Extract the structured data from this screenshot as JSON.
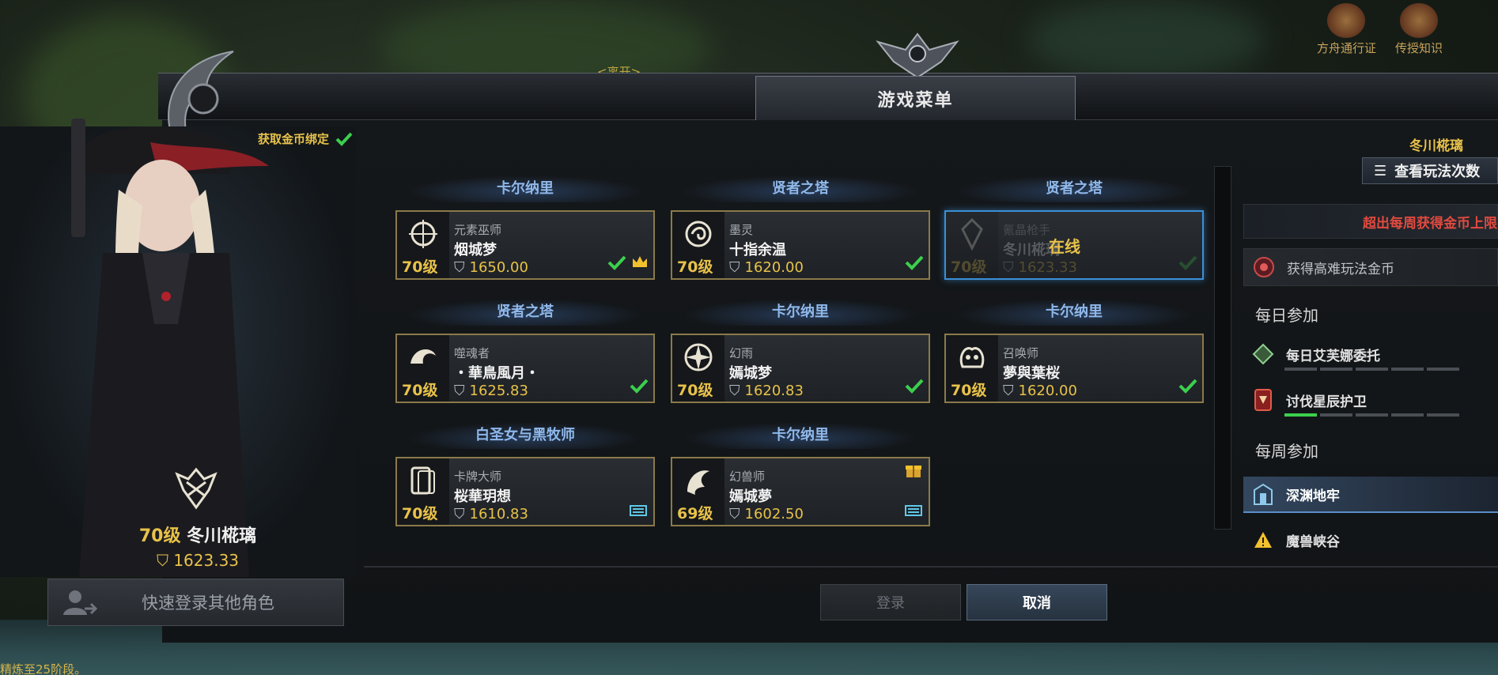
{
  "world": {
    "floating_text_1": "<离开>",
    "top_icons": [
      {
        "label": "方舟通行证",
        "icon": "ark-pass-icon"
      },
      {
        "label": "传授知识",
        "icon": "knowledge-icon"
      }
    ],
    "bottom_hint": "精炼至25阶段。"
  },
  "dialog": {
    "title": "游戏菜单",
    "gold_bound_label": "获取金币绑定"
  },
  "selected_character": {
    "level": "70级",
    "name": "冬川椛璃",
    "item_level": "1623.33",
    "quick_login_label": "快速登录其他角色"
  },
  "characters": [
    {
      "server": "卡尔纳里",
      "class": "元素巫师",
      "name": "烟城梦",
      "level": "70级",
      "item_level": "1650.00",
      "badges": [
        "check-icon",
        "crown-icon"
      ],
      "online": false
    },
    {
      "server": "贤者之塔",
      "class": "墨灵",
      "name": "十指余温",
      "level": "70级",
      "item_level": "1620.00",
      "badges": [
        "check-icon"
      ],
      "online": false
    },
    {
      "server": "贤者之塔",
      "class": "氪晶枪手",
      "name": "冬川椛璃",
      "level": "70级",
      "item_level": "1623.33",
      "badges": [
        "check-icon"
      ],
      "online": true,
      "online_label": "在线"
    },
    {
      "server": "贤者之塔",
      "class": "噬魂者",
      "name": "・華鳥風月・",
      "level": "70级",
      "item_level": "1625.83",
      "badges": [
        "check-icon"
      ],
      "online": false
    },
    {
      "server": "卡尔纳里",
      "class": "幻雨",
      "name": "嫣城梦",
      "level": "70级",
      "item_level": "1620.83",
      "badges": [
        "check-icon"
      ],
      "online": false
    },
    {
      "server": "卡尔纳里",
      "class": "召唤师",
      "name": "夢與葉桜",
      "level": "70级",
      "item_level": "1620.00",
      "badges": [
        "check-icon"
      ],
      "online": false
    },
    {
      "server": "白圣女与黑牧师",
      "class": "卡牌大师",
      "name": "桜華玥想",
      "level": "70级",
      "item_level": "1610.83",
      "badges": [
        "crystal-icon"
      ],
      "online": false
    },
    {
      "server": "卡尔纳里",
      "class": "幻兽师",
      "name": "嫣城夢",
      "level": "69级",
      "item_level": "1602.50",
      "badges": [
        "crystal-icon"
      ],
      "gift": true,
      "online": false
    }
  ],
  "buttons": {
    "login": "登录",
    "cancel": "取消"
  },
  "right_panel": {
    "name": "冬川椛璃",
    "count_button": "查看玩法次数",
    "warning": "超出每周获得金币上限",
    "hard_gold": "获得高难玩法金币",
    "daily_header": "每日参加",
    "daily": [
      {
        "label": "每日艾芙娜委托",
        "progress_filled": 0,
        "progress_total": 5
      },
      {
        "label": "讨伐星辰护卫",
        "progress_filled": 1,
        "progress_total": 5
      }
    ],
    "weekly_header": "每周参加",
    "weekly": [
      {
        "label": "深渊地牢",
        "active": true
      },
      {
        "label": "魔兽峡谷",
        "active": false
      }
    ]
  },
  "colors": {
    "gold": "#e8c24a",
    "server_blue": "#8fb8ea",
    "online_border": "#3b8fd6",
    "warning_red": "#e24a3f",
    "progress_green": "#3ccf4e"
  }
}
